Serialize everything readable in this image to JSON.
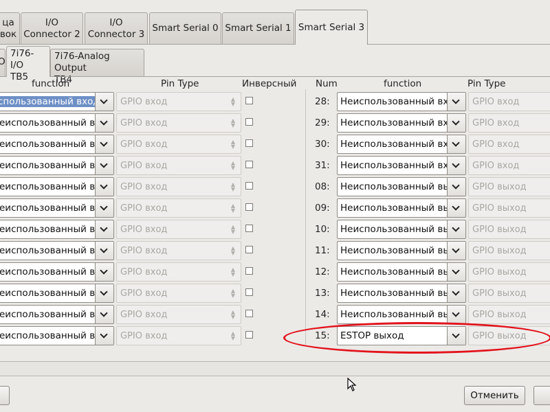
{
  "top_tabs": [
    {
      "line1": "ца",
      "line2": "вок"
    },
    {
      "line1": "I/O",
      "line2": "Connector 2"
    },
    {
      "line1": "I/O",
      "line2": "Connector 3"
    },
    {
      "label": "Smart Serial 0"
    },
    {
      "label": "Smart Serial 1"
    },
    {
      "label": "Smart Serial 3"
    }
  ],
  "sub_tabs": [
    {
      "label": "O"
    },
    {
      "line1": "7i76-I/O",
      "line2": "TB5"
    },
    {
      "line1": "7i76-Analog Output",
      "line2": "TB4"
    }
  ],
  "headers": {
    "left_function": "function",
    "left_pin_type": "Pin Type",
    "inverse": "Инверсный",
    "right_num": "Num",
    "right_function": "function",
    "right_pin_type": "Pin Type"
  },
  "left_rows": [
    {
      "function": "спользованный вход",
      "pin_type": "GPIO вход",
      "selected": true
    },
    {
      "function": "еиспользованный вх",
      "pin_type": "GPIO вход"
    },
    {
      "function": "еиспользованный вх",
      "pin_type": "GPIO вход"
    },
    {
      "function": "еиспользованный вх",
      "pin_type": "GPIO вход"
    },
    {
      "function": "еиспользованный вх",
      "pin_type": "GPIO вход"
    },
    {
      "function": "еиспользованный вх",
      "pin_type": "GPIO вход"
    },
    {
      "function": "еиспользованный вх",
      "pin_type": "GPIO вход"
    },
    {
      "function": "еиспользованный вх",
      "pin_type": "GPIO вход"
    },
    {
      "function": "еиспользованный вх",
      "pin_type": "GPIO вход"
    },
    {
      "function": "еиспользованный вх",
      "pin_type": "GPIO вход"
    },
    {
      "function": "еиспользованный вх",
      "pin_type": "GPIO вход"
    },
    {
      "function": "еиспользованный вх",
      "pin_type": "GPIO вход"
    }
  ],
  "right_rows": [
    {
      "num": "28:",
      "function": "Неиспользованный вх",
      "pin_type": "GPIO вход"
    },
    {
      "num": "29:",
      "function": "Неиспользованный вх",
      "pin_type": "GPIO вход"
    },
    {
      "num": "30:",
      "function": "Неиспользованный вх",
      "pin_type": "GPIO вход"
    },
    {
      "num": "31:",
      "function": "Неиспользованный вх",
      "pin_type": "GPIO вход"
    },
    {
      "num": "08:",
      "function": "Неиспользованный вь",
      "pin_type": "GPIO выход"
    },
    {
      "num": "09:",
      "function": "Неиспользованный вь",
      "pin_type": "GPIO выход"
    },
    {
      "num": "10:",
      "function": "Неиспользованный вь",
      "pin_type": "GPIO выход"
    },
    {
      "num": "11:",
      "function": "Неиспользованный вь",
      "pin_type": "GPIO выход"
    },
    {
      "num": "12:",
      "function": "Неиспользованный вь",
      "pin_type": "GPIO выход"
    },
    {
      "num": "13:",
      "function": "Неиспользованный вь",
      "pin_type": "GPIO выход"
    },
    {
      "num": "14:",
      "function": "Неиспользованный вь",
      "pin_type": "GPIO выход"
    },
    {
      "num": "15:",
      "function": "ESTOP выход",
      "pin_type": "GPIO выход",
      "highlighted": true
    }
  ],
  "buttons": {
    "cancel": "Отменить"
  },
  "colors": {
    "window_bg": "#eceae7",
    "selection": "#6d8fc6",
    "annotation_red": "#e3121c"
  },
  "icons": [
    "chevron-down-icon",
    "spinner-arrows-icon",
    "mouse-cursor-icon"
  ]
}
